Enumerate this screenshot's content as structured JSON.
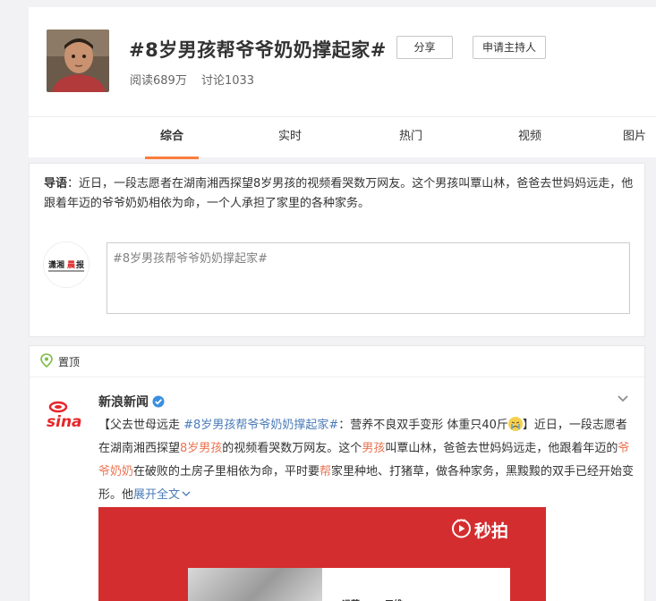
{
  "header": {
    "title": "#8岁男孩帮爷爷奶奶撑起家#",
    "share_label": "分享",
    "host_label": "申请主持人",
    "reads": "阅读689万",
    "discussions": "讨论1033"
  },
  "tabs": [
    {
      "label": "综合",
      "active": true
    },
    {
      "label": "实时",
      "active": false
    },
    {
      "label": "热门",
      "active": false
    },
    {
      "label": "视频",
      "active": false
    },
    {
      "label": "图片",
      "active": false
    }
  ],
  "guide": {
    "prefix": "导语",
    "text": "：近日，一段志愿者在湖南湘西探望8岁男孩的视频看哭数万网友。这个男孩叫覃山林，爸爸去世妈妈远走，他跟着年迈的爷爷奶奶相依为命，一个人承担了家里的各种家务。"
  },
  "compose": {
    "value": "#8岁男孩帮爷爷奶奶撑起家#"
  },
  "poster_logo_text": "潇湘晨报",
  "feed": {
    "pin_label": "置顶",
    "author": "新浪新闻",
    "post": {
      "bracket_open": "【",
      "p1": "父去世母远走 ",
      "hashtag": "#8岁男孩帮爷爷奶奶撑起家#",
      "p2": "：营养不良双手变形 体重只40斤",
      "bracket_close": "】",
      "p3": "近日，一段志愿者在湖南湘西探望",
      "h1": "8岁男孩",
      "p4": "的视频看哭数万网友。这个",
      "h2": "男孩",
      "p5": "叫覃山林，爸爸去世妈妈远走，他跟着年迈的",
      "h3": "爷爷奶奶",
      "p6": "在破败的土房子里相依为命，平时要",
      "h4": "帮",
      "p7": "家里种地、打猪草，做各种家务，黑黢黢的双手已经开始变形。他",
      "expand": "展开全文"
    },
    "media": {
      "brand": "秒拍",
      "tag1": "远芽",
      "tag2": "五维"
    }
  },
  "colors": {
    "accent": "#fa7d3c",
    "highlight": "#eb7350",
    "link": "#4a7bb9",
    "media_bg": "#d42d2f"
  }
}
